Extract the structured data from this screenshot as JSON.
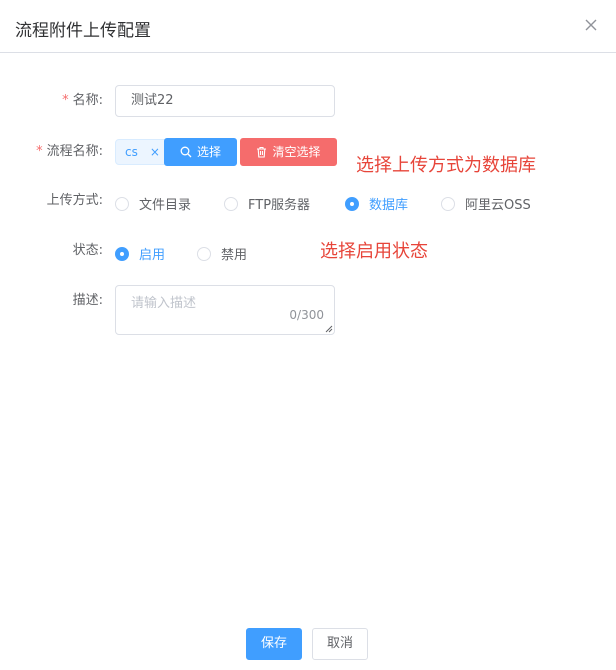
{
  "dialog": {
    "title": "流程附件上传配置"
  },
  "form": {
    "name": {
      "required": "*",
      "label": "名称:",
      "value": "测试22"
    },
    "process": {
      "required": "*",
      "label": "流程名称:",
      "tag": "cs",
      "tag_close": "×",
      "select_label": "选择",
      "clear_label": "清空选择"
    },
    "upload": {
      "label": "上传方式:",
      "options": [
        "文件目录",
        "FTP服务器",
        "数据库",
        "阿里云OSS"
      ],
      "selected": "数据库"
    },
    "status": {
      "label": "状态:",
      "options": [
        "启用",
        "禁用"
      ],
      "selected": "启用"
    },
    "description": {
      "label": "描述:",
      "placeholder": "请输入描述",
      "counter": "0/300"
    }
  },
  "annotations": [
    "选择上传方式为数据库",
    "选择启用状态"
  ],
  "footer": {
    "save_label": "保存",
    "cancel_label": "取消"
  },
  "colors": {
    "primary": "#409eff",
    "danger": "#f56c6c",
    "annotation": "#e7453a"
  }
}
